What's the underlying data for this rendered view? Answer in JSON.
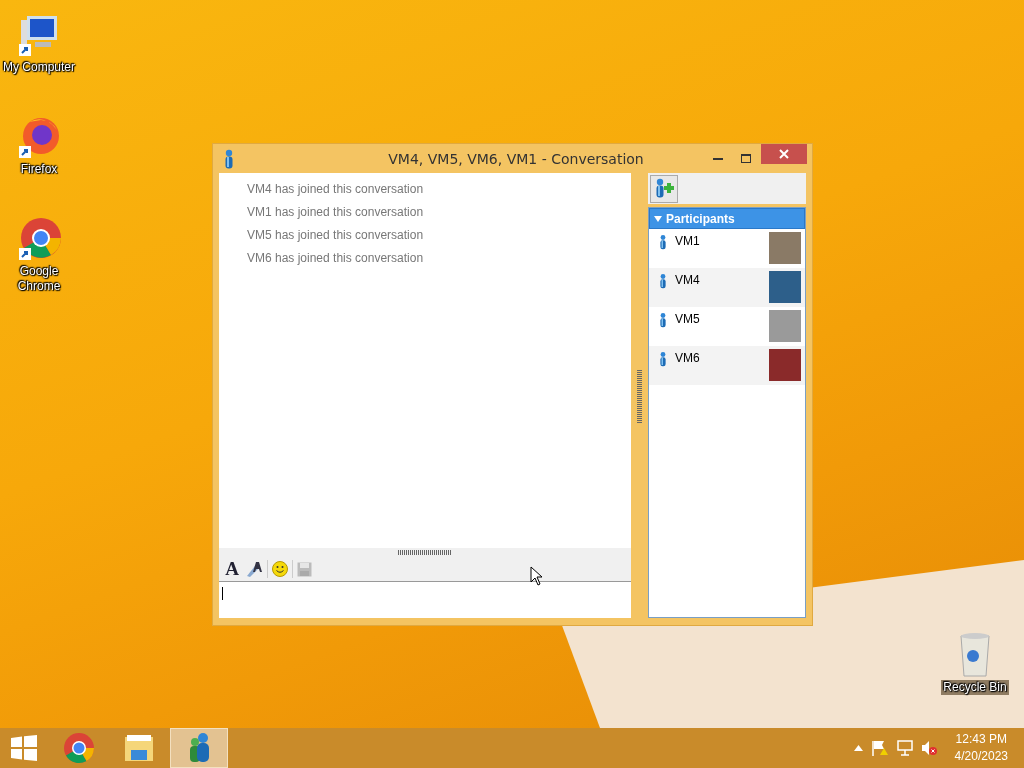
{
  "desktop_icons": [
    {
      "kind": "computer",
      "label": "My Computer"
    },
    {
      "kind": "firefox",
      "label": "Firefox"
    },
    {
      "kind": "chrome",
      "label": "Google Chrome"
    },
    {
      "kind": "recycle",
      "label": "Recycle Bin"
    }
  ],
  "window": {
    "title": "VM4, VM5, VM6, VM1 - Conversation"
  },
  "messages": [
    "VM4 has joined this conversation",
    "VM1 has joined this conversation",
    "VM5 has joined this conversation",
    "VM6 has joined this conversation"
  ],
  "toolbar": [
    {
      "kind": "font",
      "glyph": "A"
    },
    {
      "kind": "color"
    },
    {
      "kind": "emoticon"
    },
    {
      "kind": "save",
      "disabled": true
    }
  ],
  "participants": {
    "header": "Participants",
    "expanded": true,
    "items": [
      {
        "name": "VM1"
      },
      {
        "name": "VM4"
      },
      {
        "name": "VM5"
      },
      {
        "name": "VM6"
      }
    ]
  },
  "taskbar": {
    "apps": [
      {
        "kind": "chrome",
        "selected": false
      },
      {
        "kind": "explorer",
        "selected": false
      },
      {
        "kind": "messenger",
        "selected": true
      }
    ],
    "time": "12:43 PM",
    "date": "4/20/2023"
  }
}
